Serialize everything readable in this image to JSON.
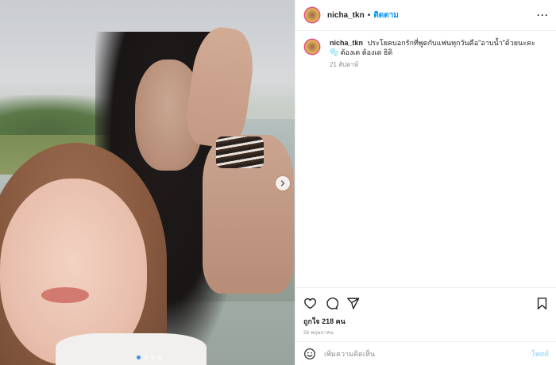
{
  "header": {
    "username": "nicha_tkn",
    "separator": "•",
    "follow_label": "ติดตาม",
    "more_label": "···"
  },
  "caption": {
    "username": "nicha_tkn",
    "text": "ประโยคบอกรักที่พูดกับแฟนทุกวันคือ\"อาบน้ำ\"ด้วยนะคะ 🫧 ต้องเด ต้องเด ธิดิ",
    "time": "21 สัปดาห์"
  },
  "media": {
    "current_slide": 1,
    "slide_count": 4
  },
  "actions": {
    "likes": "ถูกใจ 218 คน",
    "post_date": "26 พฤษภาคม"
  },
  "comment": {
    "placeholder": "เพิ่มความคิดเห็น",
    "post_label": "โพสต์"
  },
  "colors": {
    "accent": "#0095f6",
    "post_disabled": "#b2dffc",
    "muted": "#8e8e8e"
  }
}
